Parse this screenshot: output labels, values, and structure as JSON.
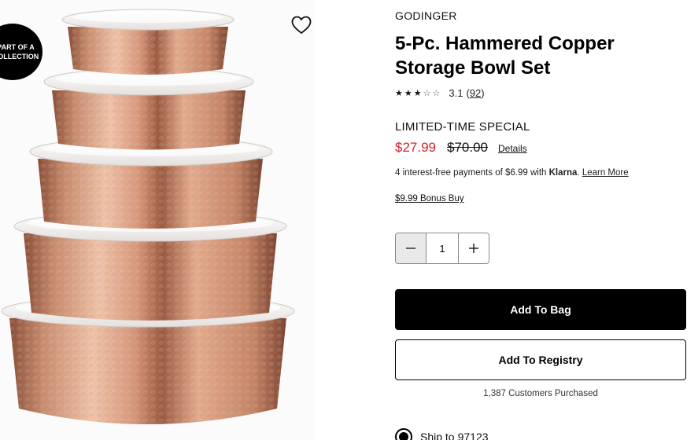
{
  "badge": {
    "line1": "PART OF A",
    "line2": "COLLECTION"
  },
  "icons": {
    "wishlist": "heart-outline-icon",
    "minus": "minus-icon",
    "plus": "plus-icon",
    "radio": "radio-selected-icon"
  },
  "product": {
    "brand": "GODINGER",
    "title": "5-Pc. Hammered Copper Storage Bowl Set",
    "rating": {
      "value": 3.1,
      "stars_text": "3.1",
      "count_open": "(",
      "count": "92",
      "count_close": ")"
    },
    "promo_label": "LIMITED-TIME SPECIAL",
    "sale_price": "$27.99",
    "original_price": "$70.00",
    "details_link": "Details",
    "klarna": {
      "text": "4 interest-free payments of $6.99 with",
      "brand": "Klarna",
      "period": ".",
      "learn_more": "Learn More"
    },
    "bonus_buy": "$9.99 Bonus Buy",
    "quantity": "1",
    "add_to_bag": "Add To Bag",
    "add_to_registry": "Add To Registry",
    "customers_purchased": "1,387 Customers Purchased",
    "ship_label": "Ship to",
    "ship_zip": "97123"
  },
  "colors": {
    "sale": "#d2232a",
    "primary_button": "#000000",
    "copper": "#c8886a"
  }
}
